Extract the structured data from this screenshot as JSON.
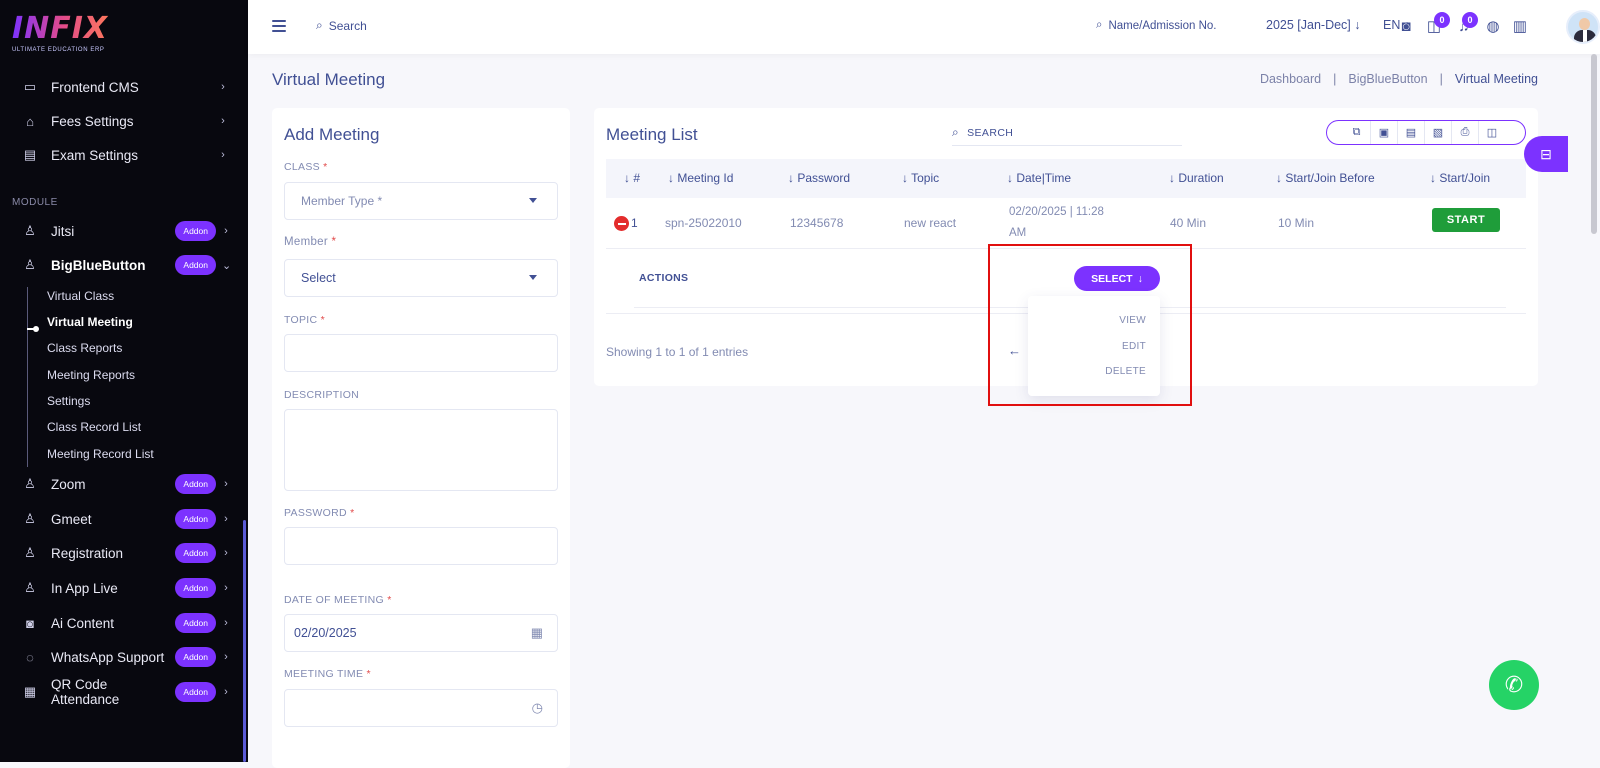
{
  "brand": {
    "name": "INFIX",
    "tagline": "ULTIMATE EDUCATION ERP"
  },
  "sidebar": {
    "top_items": [
      {
        "label": "Frontend CMS",
        "icon": "monitor-icon"
      },
      {
        "label": "Fees Settings",
        "icon": "bank-icon"
      },
      {
        "label": "Exam Settings",
        "icon": "book-icon"
      }
    ],
    "module_heading": "MODULE",
    "module_items": [
      {
        "label": "Jitsi",
        "badge": "Addon",
        "icon": "user-icon"
      },
      {
        "label": "BigBlueButton",
        "badge": "Addon",
        "icon": "user-icon"
      }
    ],
    "sub_items": [
      "Virtual Class",
      "Virtual Meeting",
      "Class Reports",
      "Meeting Reports",
      "Settings",
      "Class Record List",
      "Meeting Record List"
    ],
    "bottom_items": [
      {
        "label": "Zoom",
        "badge": "Addon",
        "icon": "user-icon"
      },
      {
        "label": "Gmeet",
        "badge": "Addon",
        "icon": "user-icon"
      },
      {
        "label": "Registration",
        "badge": "Addon",
        "icon": "user-icon"
      },
      {
        "label": "In App Live",
        "badge": "Addon",
        "icon": "user-icon"
      },
      {
        "label": "Ai Content",
        "badge": "Addon",
        "icon": "robot-icon"
      },
      {
        "label": "WhatsApp Support",
        "badge": "Addon",
        "icon": "whatsapp-icon"
      },
      {
        "label": "QR Code Attendance",
        "badge": "Addon",
        "icon": "qr-icon"
      }
    ]
  },
  "topbar": {
    "search_placeholder": "Search",
    "name_search": "Name/Admission No.",
    "year": "2025 [Jan-Dec]",
    "lang": "EN",
    "chat_count": "0",
    "notif_count": "0"
  },
  "page": {
    "title": "Virtual Meeting",
    "breadcrumbs": [
      "Dashboard",
      "BigBlueButton",
      "Virtual Meeting"
    ],
    "separator": "|"
  },
  "add_meeting": {
    "title": "Add Meeting",
    "class_label": "CLASS",
    "class_value": "Member Type *",
    "member_label": "Member",
    "member_value": "Select",
    "topic_label": "TOPIC",
    "description_label": "DESCRIPTION",
    "password_label": "PASSWORD",
    "date_label": "DATE OF MEETING",
    "date_value": "02/20/2025",
    "time_label": "MEETING TIME",
    "req": "*"
  },
  "meeting_list": {
    "title": "Meeting List",
    "search_label": "SEARCH",
    "columns": [
      "#",
      "Meeting Id",
      "Password",
      "Topic",
      "Date|Time",
      "Duration",
      "Start/Join Before",
      "Start/Join"
    ],
    "rows": [
      {
        "num": "1",
        "meeting_id": "spn-25022010",
        "password": "12345678",
        "topic": "new react",
        "date_line1": "02/20/2025 | 11:28",
        "date_line2": "AM",
        "duration": "40 Min",
        "join_before": "10 Min",
        "action": "START"
      }
    ],
    "actions_label": "ACTIONS",
    "select_label": "SELECT",
    "dropdown": [
      "VIEW",
      "EDIT",
      "DELETE"
    ],
    "showing": "Showing 1 to 1 of 1 entries"
  },
  "colors": {
    "accent": "#7c32ff",
    "text": "#415094",
    "start": "#1f9d3a",
    "highlight": "#e10f0f"
  }
}
